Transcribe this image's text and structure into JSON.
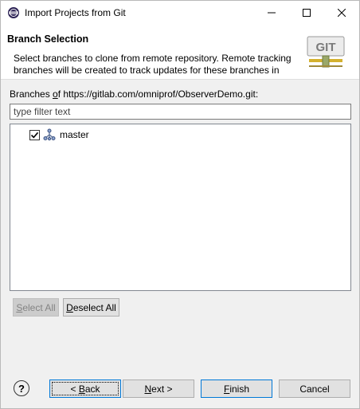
{
  "window": {
    "title": "Import Projects from Git"
  },
  "banner": {
    "title": "Branch Selection",
    "description": "Select branches to clone from remote repository. Remote tracking branches will be created to track updates for these branches in the"
  },
  "branches": {
    "label_prefix": "Branches ",
    "label_mnemonic": "o",
    "label_rest": "f https://gitlab.com/omniprof/ObserverDemo.git:",
    "filter_placeholder": "type filter text",
    "items": [
      {
        "name": "master",
        "checked": true
      }
    ]
  },
  "buttons": {
    "select_all": {
      "mnemonic": "S",
      "rest": "elect All"
    },
    "deselect_all": {
      "mnemonic": "D",
      "rest": "eselect All"
    },
    "back": {
      "prefix": "< ",
      "mnemonic": "B",
      "rest": "ack"
    },
    "next": {
      "mnemonic": "N",
      "rest": "ext >"
    },
    "finish": {
      "mnemonic": "F",
      "rest": "inish"
    },
    "cancel": {
      "label": "Cancel"
    },
    "help": {
      "label": "?"
    }
  },
  "colors": {
    "accent": "#0078d7",
    "window_bg": "#f0f0f0"
  }
}
